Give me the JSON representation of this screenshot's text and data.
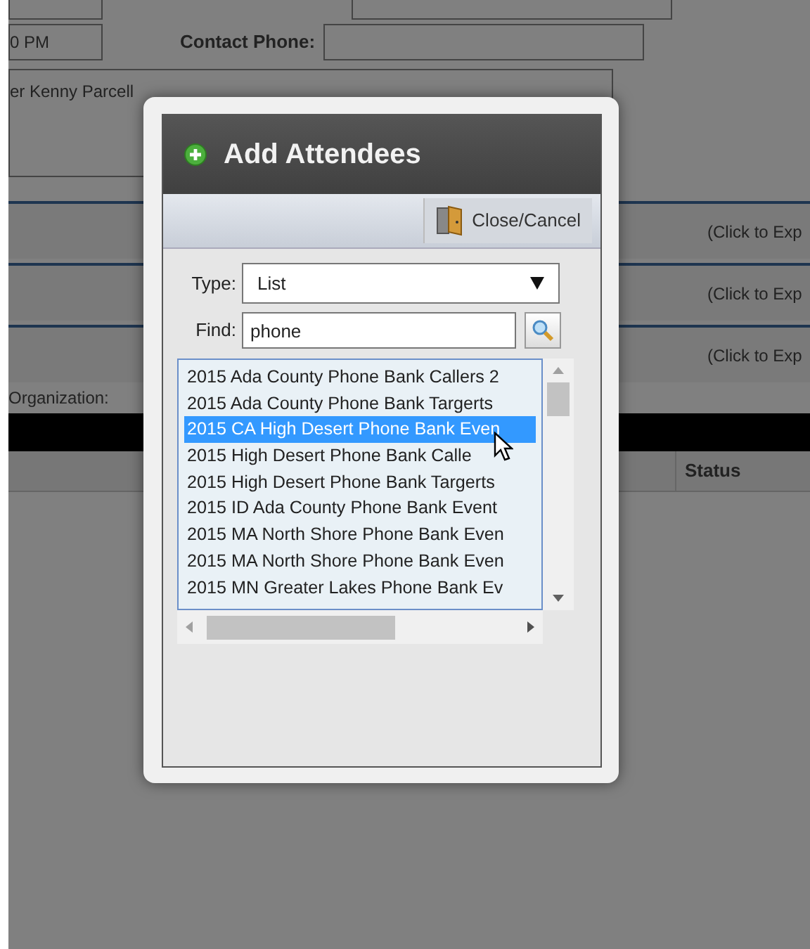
{
  "background_form": {
    "time_field": {
      "value": "0 PM"
    },
    "contact_phone": {
      "label": "Contact Phone:"
    },
    "notes_field": {
      "value": "er Kenny Parcell"
    },
    "sections": [
      {
        "hint": "(Click to Exp"
      },
      {
        "hint": "(Click to Exp"
      },
      {
        "hint": "(Click to Exp"
      }
    ],
    "organization_label": "Organization:",
    "table": {
      "columns": [
        "Status"
      ]
    }
  },
  "dialog": {
    "title": "Add Attendees",
    "close_button": "Close/Cancel",
    "type": {
      "label": "Type:",
      "value": "List"
    },
    "find": {
      "label": "Find:",
      "value": "phone"
    },
    "list": [
      {
        "text": "2015 Ada County Phone Bank Callers 2",
        "selected": false
      },
      {
        "text": "2015 Ada County Phone Bank Targerts",
        "selected": false
      },
      {
        "text": "2015 CA High Desert Phone Bank Even",
        "selected": true
      },
      {
        "text": "2015 High Desert Phone Bank Calle",
        "selected": false
      },
      {
        "text": "2015 High Desert Phone Bank Targerts",
        "selected": false
      },
      {
        "text": "2015 ID Ada County Phone Bank Event",
        "selected": false
      },
      {
        "text": "2015 MA North Shore Phone Bank Even",
        "selected": false
      },
      {
        "text": "2015 MA North Shore Phone Bank Even",
        "selected": false
      },
      {
        "text": "2015 MN Greater Lakes Phone Bank Ev",
        "selected": false
      }
    ]
  }
}
